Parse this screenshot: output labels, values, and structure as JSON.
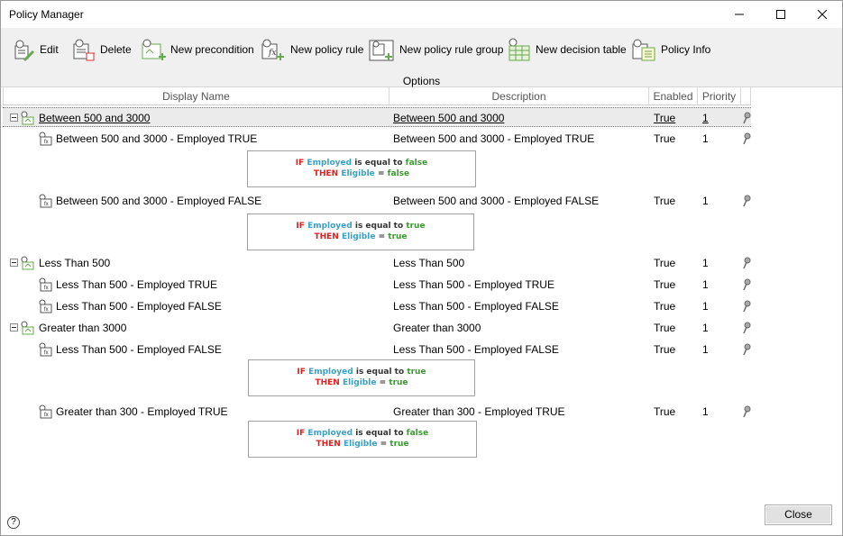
{
  "window": {
    "title": "Policy Manager"
  },
  "ribbon": {
    "buttons": [
      {
        "label": "Edit",
        "icon": "edit-icon"
      },
      {
        "label": "Delete",
        "icon": "delete-icon"
      },
      {
        "label": "New precondition",
        "icon": "new-precondition-icon"
      },
      {
        "label": "New policy rule",
        "icon": "new-policy-rule-icon"
      },
      {
        "label": "New policy rule group",
        "icon": "new-policy-rule-group-icon"
      },
      {
        "label": "New decision table",
        "icon": "new-decision-table-icon"
      },
      {
        "label": "Policy Info",
        "icon": "policy-info-icon"
      }
    ],
    "group_label": "Options"
  },
  "grid": {
    "columns": [
      "Display Name",
      "Description",
      "Enabled",
      "Priority"
    ],
    "rows": [
      {
        "name": "Between 500 and 3000",
        "description": "Between 500 and 3000",
        "enabled": "True",
        "priority": "1",
        "type": "group"
      },
      {
        "name": "Between 500 and 3000 - Employed TRUE",
        "description": "Between 500 and 3000 - Employed TRUE",
        "enabled": "True",
        "priority": "1",
        "type": "rule",
        "rule": {
          "if_kw": "IF",
          "var": "Employed",
          "op": "is equal to",
          "val": "false",
          "then_kw": "THEN",
          "then_var": "Eligible",
          "eq": "=",
          "then_val": "false"
        }
      },
      {
        "name": "Between 500 and 3000 - Employed FALSE",
        "description": "Between 500 and 3000 - Employed FALSE",
        "enabled": "True",
        "priority": "1",
        "type": "rule",
        "rule": {
          "if_kw": "IF",
          "var": "Employed",
          "op": "is equal to",
          "val": "true",
          "then_kw": "THEN",
          "then_var": "Eligible",
          "eq": "=",
          "then_val": "true"
        }
      },
      {
        "name": "Less Than 500",
        "description": "Less Than 500",
        "enabled": "True",
        "priority": "1",
        "type": "group"
      },
      {
        "name": "Less Than 500 - Employed TRUE",
        "description": "Less Than 500 - Employed TRUE",
        "enabled": "True",
        "priority": "1",
        "type": "rule"
      },
      {
        "name": "Less Than 500 - Employed FALSE",
        "description": "Less Than 500 - Employed FALSE",
        "enabled": "True",
        "priority": "1",
        "type": "rule"
      },
      {
        "name": "Greater than 3000",
        "description": "Greater than 3000",
        "enabled": "True",
        "priority": "1",
        "type": "group"
      },
      {
        "name": "Less Than 500 - Employed FALSE",
        "description": "Less Than 500 - Employed FALSE",
        "enabled": "True",
        "priority": "1",
        "type": "rule",
        "rule": {
          "if_kw": "IF",
          "var": "Employed",
          "op": "is equal to",
          "val": "true",
          "then_kw": "THEN",
          "then_var": "Eligible",
          "eq": "=",
          "then_val": "true"
        }
      },
      {
        "name": "Greater than 300 - Employed TRUE",
        "description": "Greater than 300 - Employed TRUE",
        "enabled": "True",
        "priority": "1",
        "type": "rule",
        "rule": {
          "if_kw": "IF",
          "var": "Employed",
          "op": "is equal to",
          "val": "false",
          "then_kw": "THEN",
          "then_var": "Eligible",
          "eq": "=",
          "then_val": "true"
        }
      }
    ]
  },
  "footer": {
    "help": "?",
    "close_label": "Close"
  }
}
